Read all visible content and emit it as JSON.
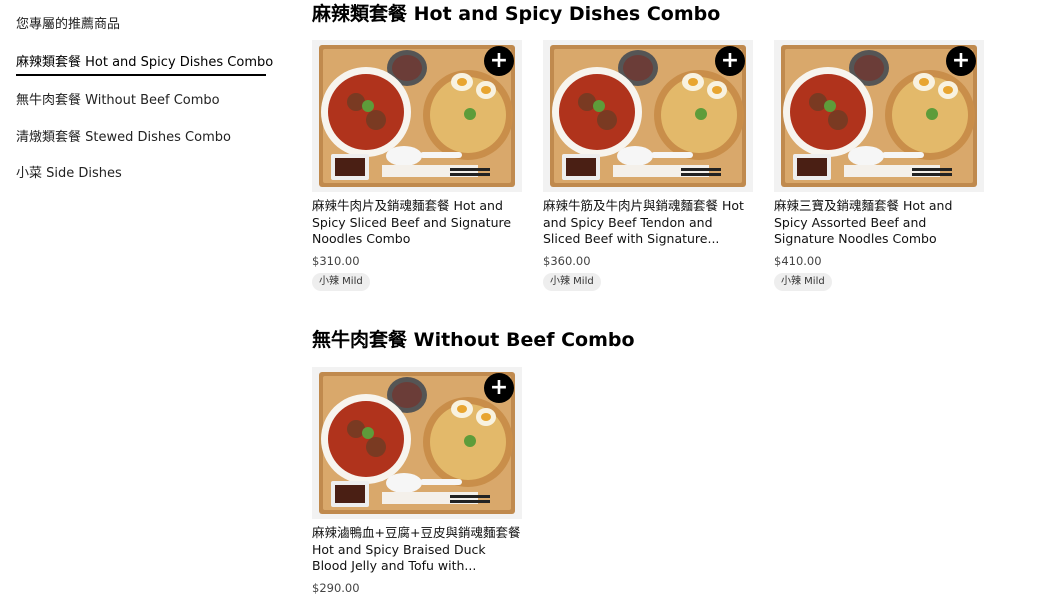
{
  "sidebar": {
    "items": [
      {
        "label": "您專屬的推薦商品"
      },
      {
        "label": "麻辣類套餐 Hot and Spicy Dishes Combo"
      },
      {
        "label": "無牛肉套餐 Without Beef Combo"
      },
      {
        "label": "清燉類套餐 Stewed Dishes Combo"
      },
      {
        "label": "小菜 Side Dishes"
      }
    ]
  },
  "sections": [
    {
      "title": "麻辣類套餐 Hot and Spicy Dishes Combo",
      "items": [
        {
          "name": "麻辣牛肉片及銷魂麵套餐 Hot and Spicy Sliced Beef and Signature Noodles Combo",
          "price": "$310.00",
          "badge": "小辣 Mild",
          "add_label": "+",
          "image_icon": "spicy-soup-meal-image"
        },
        {
          "name": "麻辣牛筋及牛肉片與銷魂麵套餐 Hot and Spicy Beef Tendon and Sliced Beef with Signature...",
          "price": "$360.00",
          "badge": "小辣 Mild",
          "add_label": "+",
          "image_icon": "spicy-soup-meal-image"
        },
        {
          "name": "麻辣三寶及銷魂麵套餐 Hot and Spicy Assorted Beef and Signature Noodles Combo",
          "price": "$410.00",
          "badge": "小辣 Mild",
          "add_label": "+",
          "image_icon": "spicy-soup-meal-image"
        }
      ]
    },
    {
      "title": "無牛肉套餐 Without Beef Combo",
      "items": [
        {
          "name": "麻辣滷鴨血+豆腐+豆皮與銷魂麵套餐 Hot and Spicy Braised Duck Blood Jelly and Tofu with...",
          "price": "$290.00",
          "add_label": "+",
          "image_icon": "spicy-soup-meal-image"
        }
      ]
    }
  ],
  "colors": {
    "tray": "#c08a4e",
    "tray_inner": "#d9a86b",
    "broth_red": "#b0331c",
    "noodles": "#e3b96a",
    "bowl": "#f7f4ee",
    "add_button": "#000000"
  }
}
